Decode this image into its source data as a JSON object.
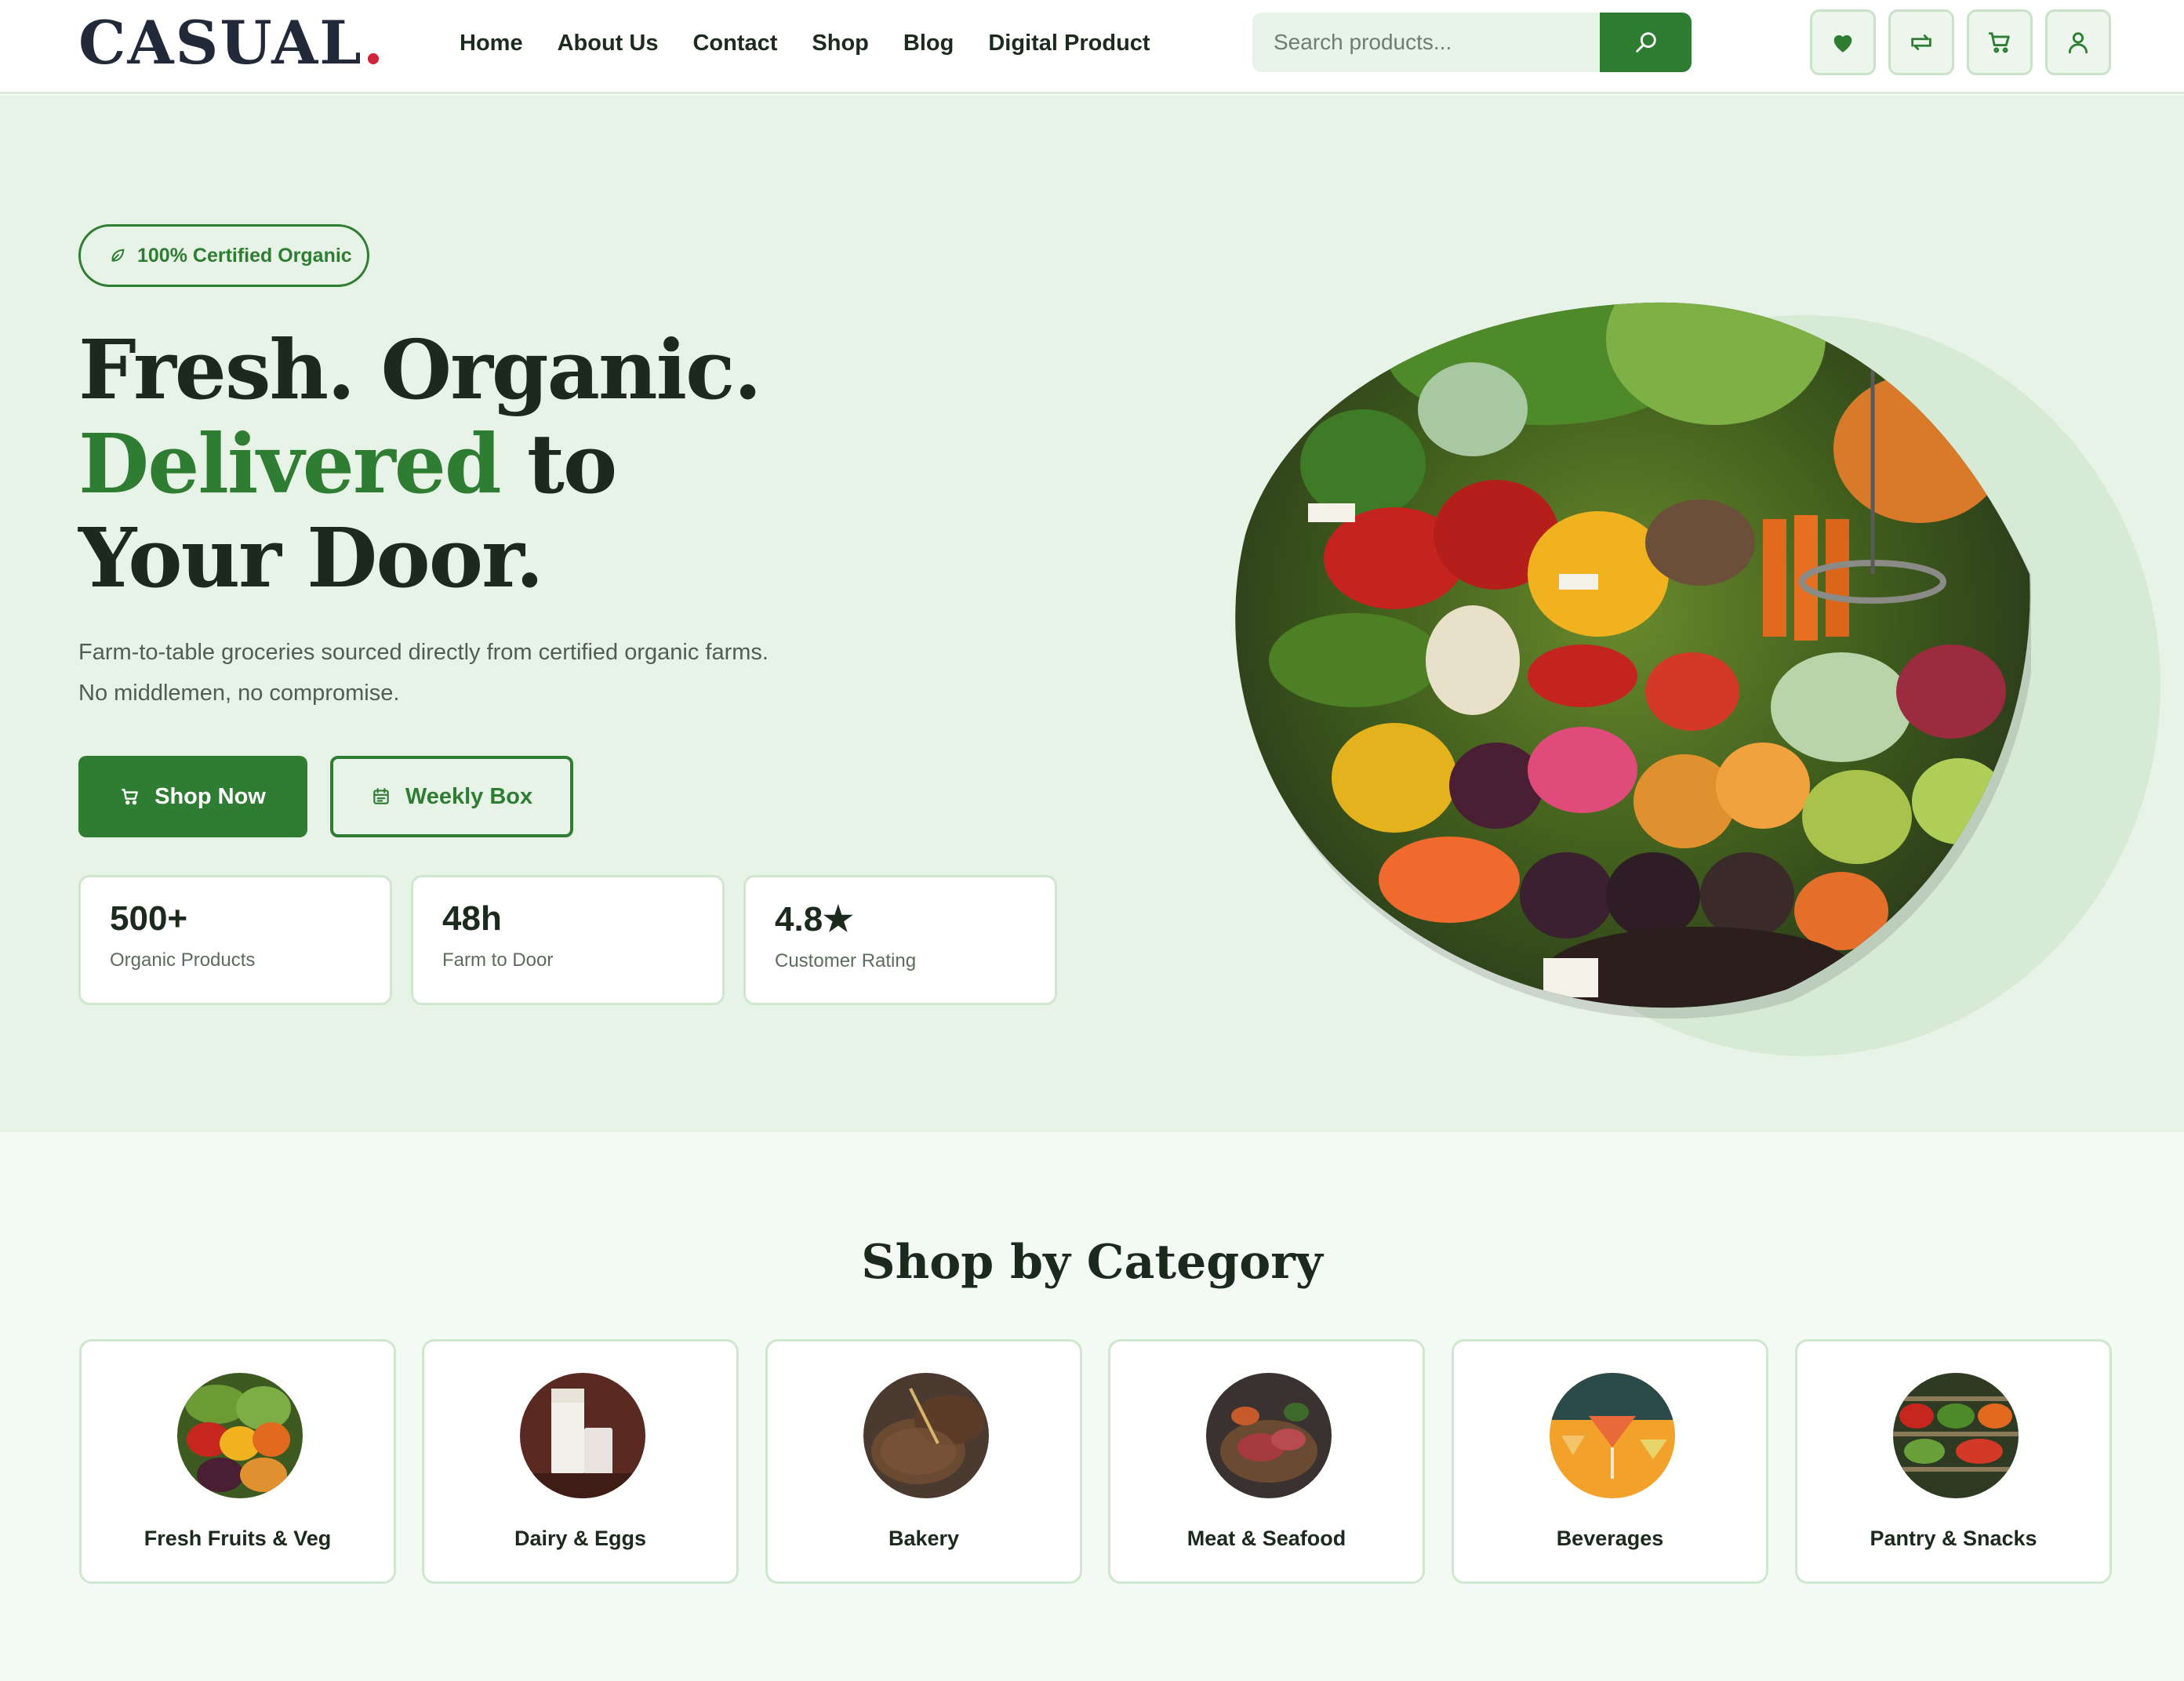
{
  "brand": {
    "logo_text": "CASUAL",
    "logo_dot": ".",
    "accent_color": "#2e7d32",
    "logo_accent_color": "#d0243b"
  },
  "nav": {
    "items": [
      {
        "label": "Home"
      },
      {
        "label": "About Us"
      },
      {
        "label": "Contact"
      },
      {
        "label": "Shop"
      },
      {
        "label": "Blog"
      },
      {
        "label": "Digital Product"
      }
    ]
  },
  "search": {
    "placeholder": "Search products...",
    "value": "",
    "button_icon": "search-icon"
  },
  "header_icons": [
    "heart-icon",
    "compare-icon",
    "cart-icon",
    "user-icon"
  ],
  "hero": {
    "badge": {
      "icon": "leaf-icon",
      "label": "100% Certified Organic"
    },
    "headline": {
      "line1": "Fresh. Organic.",
      "line2_highlight": "Delivered",
      "line2_rest": " to",
      "line3": "Your Door."
    },
    "subtitle_line1": "Farm-to-table groceries sourced directly from certified organic farms.",
    "subtitle_line2": "No middlemen, no compromise.",
    "primary_button": {
      "icon": "cart-icon",
      "label": "Shop Now"
    },
    "secondary_button": {
      "icon": "calendar-icon",
      "label": "Weekly Box"
    },
    "stats": [
      {
        "value": "500+",
        "label": "Organic Products"
      },
      {
        "value": "48h",
        "label": "Farm to Door"
      },
      {
        "value": "4.8★",
        "label": "Customer Rating"
      }
    ]
  },
  "categories": {
    "title": "Shop by Category",
    "items": [
      {
        "label": "Fresh Fruits & Veg"
      },
      {
        "label": "Dairy & Eggs"
      },
      {
        "label": "Bakery"
      },
      {
        "label": "Meat & Seafood"
      },
      {
        "label": "Beverages"
      },
      {
        "label": "Pantry & Snacks"
      }
    ]
  }
}
